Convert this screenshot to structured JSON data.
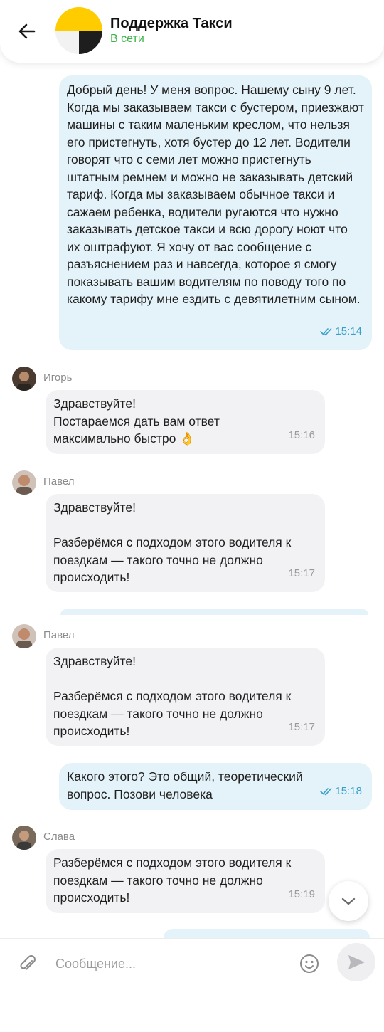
{
  "header": {
    "title": "Поддержка Такси",
    "status": "В сети"
  },
  "messages": {
    "m1": {
      "text": "Добрый день! У меня вопрос. Нашему сыну 9 лет. Когда мы заказываем такси с бустером, приезжают машины с таким маленьким креслом, что нельзя его пристегнуть, хотя бустер до 12 лет. Водители говорят что с семи лет можно пристегнуть штатным ремнем и можно не заказывать детский тариф. Когда мы заказываем обычное такси и сажаем ребенка, водители ругаются что нужно заказывать детское такси и всю дорогу ноют что их оштрафуют. Я хочу от вас сообщение с разъяснением раз и навсегда, которое я смогу показывать вашим водителям по поводу того по какому тарифу мне ездить с девятилетним сыном.",
      "time": "15:14"
    },
    "m2": {
      "sender": "Игорь",
      "text": "Здравствуйте!\nПостараемся дать вам ответ максимально быстро 👌",
      "time": "15:16"
    },
    "m3": {
      "sender": "Павел",
      "text": "Здравствуйте!\n\nРазберёмся с подходом этого водителя к поездкам — такого точно не должно происходить!",
      "time": "15:17"
    },
    "m4": {
      "sender": "Павел",
      "text": "Здравствуйте!\n\nРазберёмся с подходом этого водителя к поездкам — такого точно не должно происходить!",
      "time": "15:17"
    },
    "m5": {
      "text": "Какого этого? Это общий, теоретический вопрос. Позови человека",
      "time": "15:18"
    },
    "m6": {
      "sender": "Слава",
      "text": "Разберёмся с подходом этого водителя к поездкам — такого точно не должно происходить!",
      "time": "15:19"
    }
  },
  "composer": {
    "placeholder": "Сообщение..."
  },
  "colors": {
    "outgoing_bubble": "#e4f3f9",
    "incoming_bubble": "#f2f2f4",
    "online_status": "#3bb54a",
    "read_ticks": "#3aa0c8"
  },
  "icons": [
    "back-arrow-icon",
    "yandex-taxi-logo",
    "double-check-icon",
    "chevron-down-icon",
    "paperclip-icon",
    "emoji-icon",
    "send-icon"
  ]
}
